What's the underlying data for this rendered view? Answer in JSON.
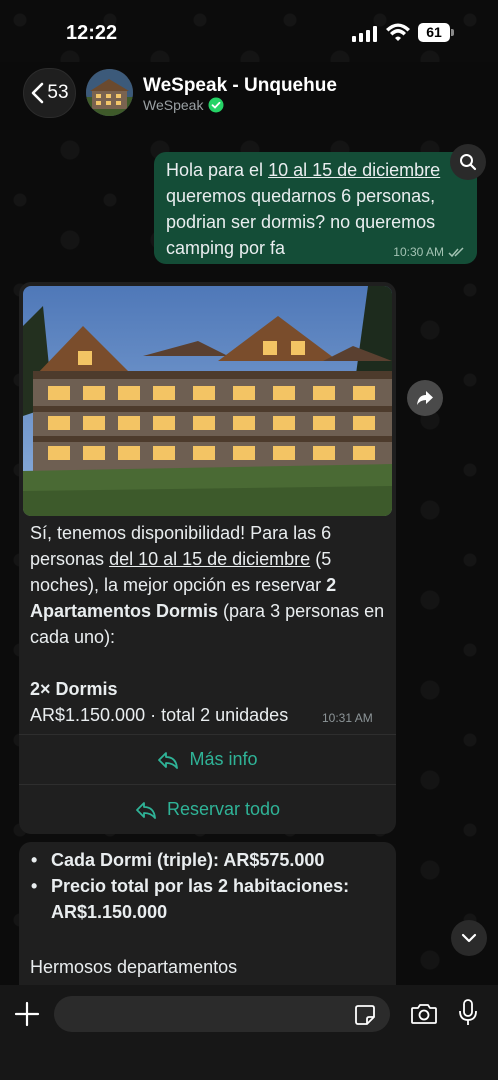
{
  "status_bar": {
    "time": "12:22",
    "battery": "61"
  },
  "header": {
    "back_count": "53",
    "contact_name": "WeSpeak - Unquehue",
    "contact_subtitle": "WeSpeak"
  },
  "messages": {
    "outgoing": {
      "text_pre": "Hola para el ",
      "text_link": "10 al 15 de diciembre",
      "text_post": " queremos quedarnos 6 personas, podrian ser dormis? no queremos camping por fa",
      "time": "10:30 AM"
    },
    "incoming": {
      "p1_pre": "Sí, tenemos disponibilidad! Para las 6 personas ",
      "p1_link": "del 10 al 15 de diciembre",
      "p1_mid": " (5 noches), la mejor opción es reservar ",
      "p1_bold": "2 Apartamentos Dormis",
      "p1_post": " (para 3 personas en cada uno):",
      "item_title": "2× Dormis",
      "item_price": "AR$1.150.000 · total 2 unidades",
      "time": "10:31 AM",
      "button_more": "Más info",
      "button_book": "Reservar todo"
    },
    "incoming_2": {
      "bullets": [
        "Cada Dormi (triple): AR$575.000",
        "Precio total por las 2 habitaciones: AR$1.150.000"
      ],
      "text": "Hermosos departamentos",
      "text_cut": "......"
    }
  },
  "composer": {
    "placeholder": ""
  },
  "colors": {
    "outgoing_bubble": "#144d37",
    "incoming_bubble": "#1f1f1f",
    "accent": "#2fb397"
  }
}
